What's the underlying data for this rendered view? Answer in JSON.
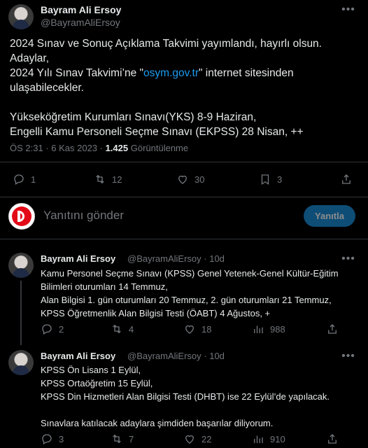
{
  "main": {
    "author_name": "Bayram Ali Ersoy",
    "author_handle": "@BayramAliErsoy",
    "text_line1": "2024 Sınav ve Sonuç Açıklama Takvimi yayımlandı, hayırlı olsun. Adaylar,",
    "text_line2_pre": "2024 Yılı Sınav Takvimi’ne \"",
    "text_line2_link": "osym.gov.tr",
    "text_line2_post": "\" internet sitesinden",
    "text_line3": "ulaşabilecekler.",
    "text_line4": "Yükseköğretim Kurumları Sınavı(YKS) 8-9 Haziran,",
    "text_line5": "Engelli Kamu Personeli Seçme Sınavı (EKPSS) 28 Nisan, ++",
    "time": "ÖS 2:31 · 6 Kas 2023 · ",
    "views_count": "1.425",
    "views_label": " Görüntülenme",
    "replies": "1",
    "retweets": "12",
    "likes": "30",
    "bookmarks": "3"
  },
  "reply_box": {
    "placeholder": "Yanıtını gönder",
    "button_label": "Yanıtla"
  },
  "replies": [
    {
      "author_name": "Bayram Ali Ersoy",
      "meta": "@BayramAliErsoy · 10d",
      "lines": [
        "Kamu Personel Seçme Sınavı (KPSS) Genel Yetenek-Genel Kültür-Eğitim",
        "Bilimleri oturumları 14 Temmuz,",
        "Alan Bilgisi 1. gün oturumları 20 Temmuz, 2. gün oturumları 21 Temmuz,",
        "KPSS Öğretmenlik Alan Bilgisi Testi (ÖABT) 4 Ağustos, +"
      ],
      "replies": "2",
      "retweets": "4",
      "likes": "18",
      "views": "988"
    },
    {
      "author_name": "Bayram Ali Ersoy",
      "meta": "@BayramAliErsoy · 10d",
      "lines": [
        "KPSS Ön Lisans 1 Eylül,",
        "KPSS Ortaöğretim 15 Eylül,",
        "KPSS Din Hizmetleri Alan Bilgisi Testi (DHBT) ise 22 Eylül’de yapılacak.",
        "",
        "Sınavlara katılacak adaylara şimdiden başarılar diliyorum."
      ],
      "replies": "3",
      "retweets": "7",
      "likes": "22",
      "views": "910"
    }
  ],
  "icons": {
    "more": "more-icon",
    "reply": "reply-icon",
    "retweet": "retweet-icon",
    "like": "heart-icon",
    "bookmark": "bookmark-icon",
    "share": "share-icon",
    "views": "views-icon"
  },
  "colors": {
    "background": "#000000",
    "text": "#e7e9ea",
    "muted": "#71767b",
    "link": "#1d9bf0",
    "divider": "#2f3336",
    "brand_red": "#e30a17"
  }
}
